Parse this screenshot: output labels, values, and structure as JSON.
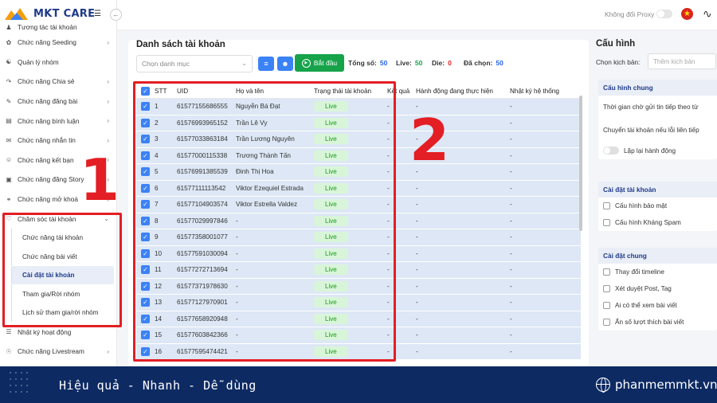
{
  "app": {
    "logo_text": "MKT CARE"
  },
  "topbar": {
    "proxy_label": "Không đổi Proxy"
  },
  "sidebar": {
    "items": [
      {
        "label": "Tương tác tài khoản",
        "icon": "users-icon",
        "arrow": ""
      },
      {
        "label": "Chức năng Seeding",
        "icon": "seeding-icon",
        "arrow": ">"
      },
      {
        "label": "Quản lý nhóm",
        "icon": "group-icon",
        "arrow": ""
      },
      {
        "label": "Chức năng Chia sẻ",
        "icon": "share-icon",
        "arrow": ">"
      },
      {
        "label": "Chức năng đăng bài",
        "icon": "post-icon",
        "arrow": ">"
      },
      {
        "label": "Chức năng bình luận",
        "icon": "comment-icon",
        "arrow": ">"
      },
      {
        "label": "Chức năng nhắn tin",
        "icon": "message-icon",
        "arrow": ">"
      },
      {
        "label": "Chức năng kết bạn",
        "icon": "add-friend-icon",
        "arrow": ">"
      },
      {
        "label": "Chức năng đăng Story",
        "icon": "story-icon",
        "arrow": ">"
      },
      {
        "label": "Chức năng mở khoá",
        "icon": "unlock-icon",
        "arrow": ">"
      },
      {
        "label": "Chăm sóc tài khoản",
        "icon": "care-icon",
        "arrow": "v"
      }
    ],
    "subitems": [
      {
        "label": "Chức năng tài khoản"
      },
      {
        "label": "Chức năng bài viết"
      },
      {
        "label": "Cài đặt tài khoản"
      },
      {
        "label": "Tham gia/Rời nhóm"
      },
      {
        "label": "Lịch sử tham gia/rời nhóm"
      }
    ],
    "bottom_items": [
      {
        "label": "Nhật ký hoạt động",
        "icon": "log-icon",
        "arrow": ""
      },
      {
        "label": "Chức năng Livestream",
        "icon": "livestream-icon",
        "arrow": ">"
      }
    ],
    "active_subitem": "Cài đặt tài khoản"
  },
  "annotations": {
    "num1": "1",
    "num2": "2"
  },
  "list": {
    "title": "Danh sách tài khoản",
    "category_placeholder": "Chọn danh mục",
    "start_label": "Bắt đầu",
    "stats": {
      "total_label": "Tổng số:",
      "total": "50",
      "live_label": "Live:",
      "live": "50",
      "die_label": "Die:",
      "die": "0",
      "selected_label": "Đã chọn:",
      "selected": "50"
    },
    "columns": [
      "STT",
      "UID",
      "Họ và tên",
      "Trạng thái tài khoản",
      "Kết quả",
      "Hành động đang thực hiện",
      "Nhật ký hệ thống"
    ],
    "rows": [
      {
        "stt": "1",
        "uid": "61577155686555",
        "name": "Nguyễn Bá Đạt",
        "status": "Live",
        "result": "-",
        "action": "-",
        "log": "-"
      },
      {
        "stt": "2",
        "uid": "61576993965152",
        "name": "Trần Lê Vy",
        "status": "Live",
        "result": "-",
        "action": "-",
        "log": "-"
      },
      {
        "stt": "3",
        "uid": "61577033863184",
        "name": "Trần Lương Nguyên",
        "status": "Live",
        "result": "-",
        "action": "-",
        "log": "-"
      },
      {
        "stt": "4",
        "uid": "61577000115338",
        "name": "Trương Thành Tấn",
        "status": "Live",
        "result": "-",
        "action": "-",
        "log": "-"
      },
      {
        "stt": "5",
        "uid": "61576991385539",
        "name": "Đinh Thị Hoa",
        "status": "Live",
        "result": "-",
        "action": "-",
        "log": "-"
      },
      {
        "stt": "6",
        "uid": "61577111113542",
        "name": "Viktor Ezequiel Estrada",
        "status": "Live",
        "result": "-",
        "action": "-",
        "log": "-"
      },
      {
        "stt": "7",
        "uid": "61577104903574",
        "name": "Viktor Estrella Valdez",
        "status": "Live",
        "result": "-",
        "action": "-",
        "log": "-"
      },
      {
        "stt": "8",
        "uid": "61577029997846",
        "name": "-",
        "status": "Live",
        "result": "-",
        "action": "-",
        "log": "-"
      },
      {
        "stt": "9",
        "uid": "61577358001077",
        "name": "-",
        "status": "Live",
        "result": "-",
        "action": "-",
        "log": "-"
      },
      {
        "stt": "10",
        "uid": "61577591030094",
        "name": "-",
        "status": "Live",
        "result": "-",
        "action": "-",
        "log": "-"
      },
      {
        "stt": "11",
        "uid": "61577272713694",
        "name": "-",
        "status": "Live",
        "result": "-",
        "action": "-",
        "log": "-"
      },
      {
        "stt": "12",
        "uid": "61577371978630",
        "name": "-",
        "status": "Live",
        "result": "-",
        "action": "-",
        "log": "-"
      },
      {
        "stt": "13",
        "uid": "61577127970901",
        "name": "-",
        "status": "Live",
        "result": "-",
        "action": "-",
        "log": "-"
      },
      {
        "stt": "14",
        "uid": "61577658920948",
        "name": "-",
        "status": "Live",
        "result": "-",
        "action": "-",
        "log": "-"
      },
      {
        "stt": "15",
        "uid": "61577603842366",
        "name": "-",
        "status": "Live",
        "result": "-",
        "action": "-",
        "log": "-"
      },
      {
        "stt": "16",
        "uid": "61577595474421",
        "name": "-",
        "status": "Live",
        "result": "-",
        "action": "-",
        "log": "-"
      }
    ]
  },
  "config": {
    "title": "Cấu hình",
    "scenario_label": "Chọn kịch bản:",
    "scenario_placeholder": "Thêm kịch bản",
    "general": {
      "head": "Cấu hình chung",
      "rows": [
        "Thời gian chờ gửi tin tiếp theo từ",
        "Chuyển tài khoản nếu lỗi liên tiếp"
      ],
      "toggle_label": "Lặp lại hành động"
    },
    "account": {
      "head": "Cài đặt tài khoản",
      "rows": [
        "Cấu hình bảo mật",
        "Cấu hình Kháng Spam"
      ]
    },
    "common": {
      "head": "Cài đặt chung",
      "rows": [
        "Thay đổi timeline",
        "Xét duyệt Post, Tag",
        "Ai có thể xem bài viết",
        "Ẩn số lượt thích bài viết"
      ]
    }
  },
  "footer": {
    "slogan": "Hiệu quả - Nhanh  - Dễ dùng",
    "site": "phanmemmkt.vn"
  },
  "colors": {
    "brand": "#1e3a8a",
    "accent": "#3b82f6",
    "highlight": "#e31e24",
    "footer_bg": "#0d2a63",
    "live_bg": "#d9f5d9",
    "start_btn": "#16a34a"
  }
}
